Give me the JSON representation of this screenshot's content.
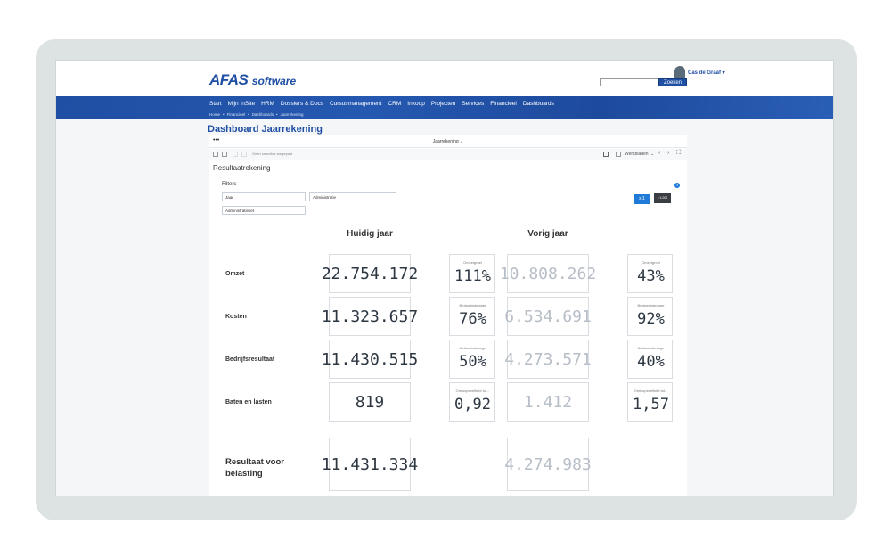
{
  "app": {
    "logo_main": "AFAS",
    "logo_sub": "software"
  },
  "user": {
    "name": "Cas de Graaf ▾"
  },
  "search": {
    "button": "Zoeken",
    "value": ""
  },
  "nav": {
    "items": [
      "Start",
      "Mijn InSite",
      "HRM",
      "Dossiers & Docs",
      "Cursusmanagement",
      "CRM",
      "Inkoop",
      "Projecten",
      "Services",
      "Financieel",
      "Dashboards"
    ]
  },
  "breadcrumb": [
    "Home",
    "•",
    "Financieel",
    "•",
    "Dashboards",
    "•",
    "Jaarrekening"
  ],
  "page": {
    "title": "Dashboard Jaarrekening"
  },
  "tabs": {
    "dots": "•••",
    "selected": "Jaarrekening ⌄"
  },
  "toolbar": {
    "selection_text": "Geen selecties toegepast",
    "worksheets": "Werkbladen",
    "chevron_down": "⌄",
    "prev": "‹",
    "next": "›",
    "fullscreen": "⛶"
  },
  "section": {
    "title": "Resultaatrekening"
  },
  "filters": {
    "label": "Filters",
    "items": [
      "Jaar",
      "Administratie",
      "Administratieset"
    ]
  },
  "scale": {
    "x1": "x 1",
    "x1000": "x 1.000"
  },
  "columns": {
    "current": "Huidig jaar",
    "previous": "Vorig jaar"
  },
  "rows": [
    {
      "label": "Omzet",
      "current": "22.754.172",
      "kpi1_label": "Omzetgroei",
      "kpi1_value": "111%",
      "previous": "10.808.262",
      "kpi2_label": "Omzetgroei",
      "kpi2_value": "43%"
    },
    {
      "label": "Kosten",
      "current": "11.323.657",
      "kpi1_label": "Brutowinstmarge",
      "kpi1_value": "76%",
      "previous": "6.534.691",
      "kpi2_label": "Brutowinstmarge",
      "kpi2_value": "92%"
    },
    {
      "label": "Bedrijfsresultaat",
      "current": "11.430.515",
      "kpi1_label": "Nettowinstmarge",
      "kpi1_value": "50%",
      "previous": "4.273.571",
      "kpi2_label": "Nettowinstmarge",
      "kpi2_value": "40%"
    },
    {
      "label": "Baten en lasten",
      "current": "819",
      "kpi1_label": "Omloopsnelheid tot...",
      "kpi1_value": "0,92",
      "previous": "1.412",
      "kpi2_label": "Omloopsnelheid tot...",
      "kpi2_value": "1,57"
    }
  ],
  "result": {
    "label": "Resultaat voor belasting",
    "current": "11.431.334",
    "previous": "4.274.983"
  }
}
